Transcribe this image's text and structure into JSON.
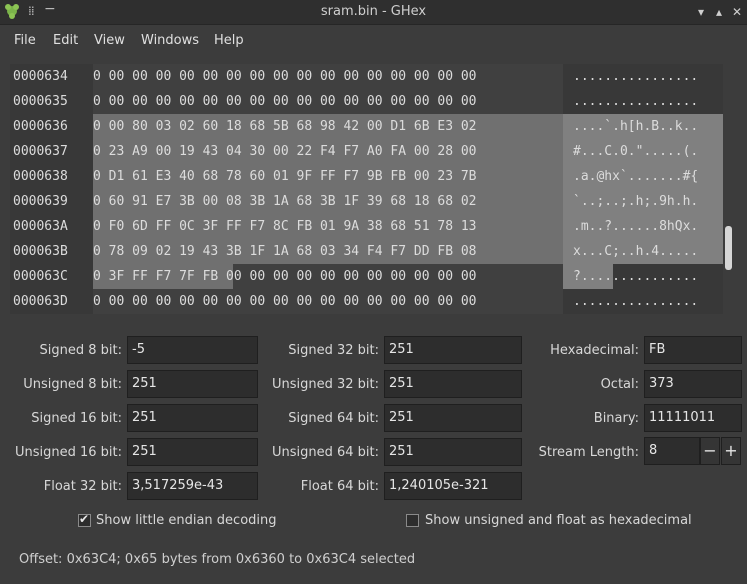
{
  "window": {
    "title": "sram.bin - GHex"
  },
  "menu": [
    "File",
    "Edit",
    "View",
    "Windows",
    "Help"
  ],
  "hex_rows": [
    {
      "offset": "0000634",
      "hex": "0 00 00 00 00 00 00 00 00 00 00 00 00 00 00 00 00",
      "ascii": "................"
    },
    {
      "offset": "0000635",
      "hex": "0 00 00 00 00 00 00 00 00 00 00 00 00 00 00 00 00",
      "ascii": "................"
    },
    {
      "offset": "0000636",
      "hex": "0 00 80 03 02 60 18 68 5B 68 98 42 00 D1 6B E3 02",
      "ascii": "....`.h[h.B..k.."
    },
    {
      "offset": "0000637",
      "hex": "0 23 A9 00 19 43 04 30 00 22 F4 F7 A0 FA 00 28 00",
      "ascii": "#...C.0.\".....(."
    },
    {
      "offset": "0000638",
      "hex": "0 D1 61 E3 40 68 78 60 01 9F FF F7 9B FB 00 23 7B",
      "ascii": ".a.@hx`.......#{"
    },
    {
      "offset": "0000639",
      "hex": "0 60 91 E7 3B 00 08 3B 1A 68 3B 1F 39 68 18 68 02",
      "ascii": "`..;..;.h;.9h.h."
    },
    {
      "offset": "000063A",
      "hex": "0 F0 6D FF 0C 3F FF F7 8C FB 01 9A 38 68 51 78 13",
      "ascii": ".m..?......8hQx."
    },
    {
      "offset": "000063B",
      "hex": "0 78 09 02 19 43 3B 1F 1A 68 03 34 F4 F7 DD FB 08",
      "ascii": "x...C;..h.4....."
    },
    {
      "offset": "000063C",
      "hex": "0 3F FF F7 7F FB 00 00 00 00 00 00 00 00 00 00 00",
      "ascii": "?..............."
    },
    {
      "offset": "000063D",
      "hex": "0 00 00 00 00 00 00 00 00 00 00 00 00 00 00 00 00",
      "ascii": "................"
    }
  ],
  "inspector": {
    "signed8_label": "Signed 8 bit:",
    "signed8": "-5",
    "unsigned8_label": "Unsigned 8 bit:",
    "unsigned8": "251",
    "signed16_label": "Signed 16 bit:",
    "signed16": "251",
    "unsigned16_label": "Unsigned 16 bit:",
    "unsigned16": "251",
    "float32_label": "Float 32 bit:",
    "float32": "3,517259e-43",
    "signed32_label": "Signed 32 bit:",
    "signed32": "251",
    "unsigned32_label": "Unsigned 32 bit:",
    "unsigned32": "251",
    "signed64_label": "Signed 64 bit:",
    "signed64": "251",
    "unsigned64_label": "Unsigned 64 bit:",
    "unsigned64": "251",
    "float64_label": "Float 64 bit:",
    "float64": "1,240105e-321",
    "hex_label": "Hexadecimal:",
    "hex": "FB",
    "octal_label": "Octal:",
    "octal": "373",
    "binary_label": "Binary:",
    "binary": "11111011",
    "stream_label": "Stream Length:",
    "stream": "8",
    "minus": "−",
    "plus": "+"
  },
  "options": {
    "little_endian": "Show little endian decoding",
    "little_endian_checked": true,
    "unsigned_hex": "Show unsigned and float as hexadecimal",
    "unsigned_hex_checked": false
  },
  "status": "Offset: 0x63C4; 0x65 bytes from 0x6360 to 0x63C4 selected",
  "colors": {
    "selection": "#707070",
    "background": "#3c3c3c",
    "app_icon": "#7bb34a"
  }
}
